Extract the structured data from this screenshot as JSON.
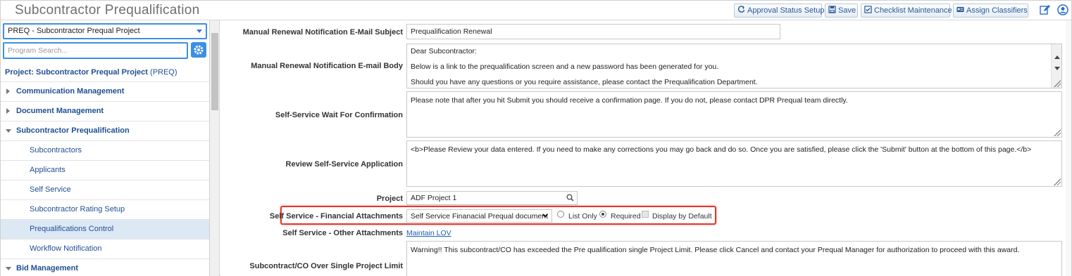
{
  "app": {
    "title": "Subcontractor Prequalification"
  },
  "toolbar": {
    "approval_label": "Approval Status Setup",
    "save_label": "Save",
    "checklist_label": "Checklist Maintenance",
    "classifiers_label": "Assign Classifiers"
  },
  "sidebar": {
    "program": "PREQ - Subcontractor Prequal Project",
    "search_placeholder": "Program Search...",
    "project_label": "Project:",
    "project_name": "Subcontractor Prequal Project",
    "project_code": "(PREQ)",
    "items": [
      {
        "label": "Communication Management",
        "type": "category",
        "expanded": false
      },
      {
        "label": "Document Management",
        "type": "category",
        "expanded": false
      },
      {
        "label": "Subcontractor Prequalification",
        "type": "category",
        "expanded": true
      },
      {
        "label": "Subcontractors",
        "type": "sub"
      },
      {
        "label": "Applicants",
        "type": "sub"
      },
      {
        "label": "Self Service",
        "type": "sub"
      },
      {
        "label": "Subcontractor Rating Setup",
        "type": "sub"
      },
      {
        "label": "Prequalifications Control",
        "type": "sub",
        "active": true
      },
      {
        "label": "Workflow Notification",
        "type": "sub"
      },
      {
        "label": "Bid Management",
        "type": "category",
        "expanded": true
      }
    ]
  },
  "form": {
    "subject_label": "Manual Renewal Notification E-Mail Subject",
    "subject_value": "Prequalification Renewal",
    "body_label": "Manual Renewal Notification E-mail Body",
    "body_lines": [
      "Dear Subcontractor:",
      "Below is a link to the prequalification screen and a new password has been generated for you.",
      "Should you have any questions or you require assistance, please contact the Prequalification Department."
    ],
    "wait_label": "Self-Service Wait For Confirmation",
    "wait_value": "Please note that after you hit Submit you should receive a confirmation page.  If you do not, please contact DPR Prequal team directly.",
    "review_label": "Review Self-Service Application",
    "review_value": "<b>Please Review your data entered.  If you need to make any corrections you may go back and do so.  Once you are satisfied, please click the 'Submit' button at the bottom of this page.</b>",
    "project_label": "Project",
    "project_value": "ADF Project 1",
    "fin_label": "Self Service - Financial Attachments",
    "fin_value": "Self Service Finanacial Prequal document",
    "opt_list_only": "List Only",
    "opt_required": "Required",
    "opt_display_default": "Display by Default",
    "selected_option": "Required",
    "other_label": "Self Service - Other Attachments",
    "other_link": "Maintain LOV",
    "over_label": "Subcontract/CO Over Single Project Limit",
    "over_value": "Warning!! This subcontract/CO has exceeded the Pre qualification single Project Limit. Please click Cancel and contact your Prequal Manager for authorization to proceed with this award."
  },
  "colors": {
    "accent": "#3d8fe4",
    "link": "#1f4f91",
    "highlight": "#e0392f",
    "active_row": "#dde8f5"
  }
}
